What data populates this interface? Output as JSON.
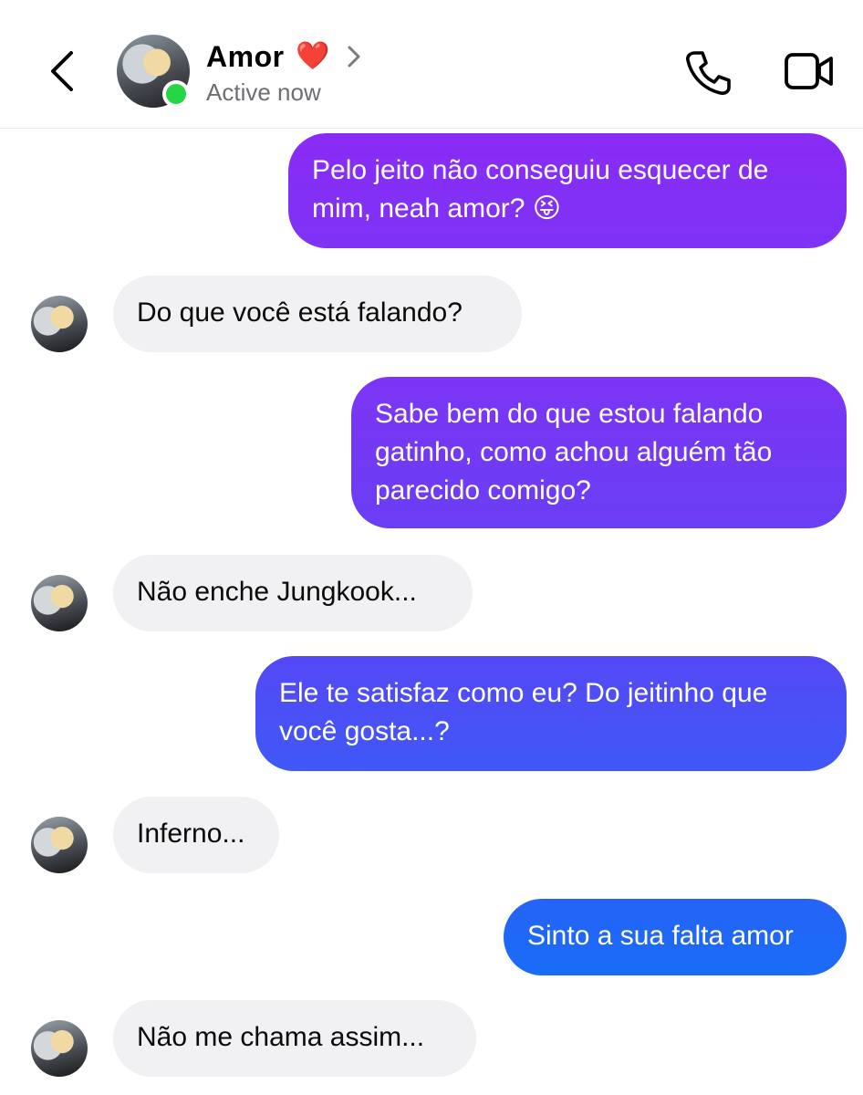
{
  "header": {
    "contact_name": "Amor",
    "heart_emoji": "❤️",
    "status": "Active now",
    "icons": [
      "back-arrow-icon",
      "chevron-right-icon",
      "phone-icon",
      "video-camera-icon"
    ],
    "online_color": "#27d645"
  },
  "colors": {
    "incoming_bubble": "#f1f1f3",
    "outgoing_gradient_top": "#8a2bf5",
    "outgoing_gradient_bottom": "#1a6cf7"
  },
  "messages": [
    {
      "direction": "outgoing",
      "text": "Pelo jeito não conseguiu esquecer de\nmim, neah amor? 😝"
    },
    {
      "direction": "incoming",
      "text": "Do que você está falando?"
    },
    {
      "direction": "outgoing",
      "text": "Sabe bem do que estou falando\ngatinho, como achou alguém tão\nparecido comigo?"
    },
    {
      "direction": "incoming",
      "text": "Não enche Jungkook..."
    },
    {
      "direction": "outgoing",
      "text": "Ele te satisfaz como eu? Do jeitinho que\nvocê gosta...?"
    },
    {
      "direction": "incoming",
      "text": "Inferno..."
    },
    {
      "direction": "outgoing",
      "text": "Sinto a sua falta amor"
    },
    {
      "direction": "incoming",
      "text": "Não me chama assim..."
    }
  ]
}
